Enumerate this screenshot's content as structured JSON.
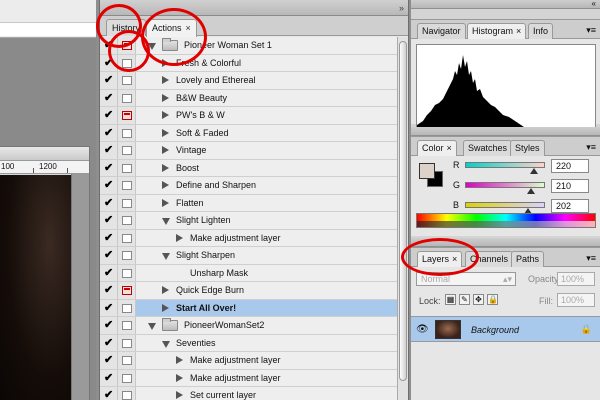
{
  "workspace": {
    "ruler_labels": [
      "100",
      "1200"
    ]
  },
  "actions_panel": {
    "tabs": [
      {
        "label": "History",
        "active": false
      },
      {
        "label": "Actions",
        "active": true,
        "close": "×"
      }
    ],
    "menu_icon": "panel-menu-icon",
    "rows": [
      {
        "check": true,
        "dialog": "red",
        "expand": "down",
        "folder": true,
        "indent": 0,
        "label": "Pioneer Woman Set 1"
      },
      {
        "check": true,
        "dialog": "empty",
        "expand": "right",
        "folder": false,
        "indent": 1,
        "label": "Fresh & Colorful"
      },
      {
        "check": true,
        "dialog": "empty",
        "expand": "right",
        "folder": false,
        "indent": 1,
        "label": "Lovely and Ethereal"
      },
      {
        "check": true,
        "dialog": "empty",
        "expand": "right",
        "folder": false,
        "indent": 1,
        "label": "B&W Beauty"
      },
      {
        "check": true,
        "dialog": "red",
        "expand": "right",
        "folder": false,
        "indent": 1,
        "label": "PW's B & W"
      },
      {
        "check": true,
        "dialog": "empty",
        "expand": "right",
        "folder": false,
        "indent": 1,
        "label": "Soft & Faded"
      },
      {
        "check": true,
        "dialog": "empty",
        "expand": "right",
        "folder": false,
        "indent": 1,
        "label": "Vintage"
      },
      {
        "check": true,
        "dialog": "empty",
        "expand": "right",
        "folder": false,
        "indent": 1,
        "label": "Boost"
      },
      {
        "check": true,
        "dialog": "empty",
        "expand": "right",
        "folder": false,
        "indent": 1,
        "label": "Define and Sharpen"
      },
      {
        "check": true,
        "dialog": "empty",
        "expand": "right",
        "folder": false,
        "indent": 1,
        "label": "Flatten"
      },
      {
        "check": true,
        "dialog": "empty",
        "expand": "down",
        "folder": false,
        "indent": 1,
        "label": "Slight Lighten"
      },
      {
        "check": true,
        "dialog": "empty",
        "expand": "right",
        "folder": false,
        "indent": 2,
        "label": "Make adjustment layer"
      },
      {
        "check": true,
        "dialog": "empty",
        "expand": "down",
        "folder": false,
        "indent": 1,
        "label": "Slight Sharpen"
      },
      {
        "check": true,
        "dialog": "empty",
        "expand": "none",
        "folder": false,
        "indent": 2,
        "label": "Unsharp Mask"
      },
      {
        "check": true,
        "dialog": "red",
        "expand": "right",
        "folder": false,
        "indent": 1,
        "label": "Quick Edge Burn"
      },
      {
        "check": true,
        "dialog": "empty",
        "expand": "right",
        "folder": false,
        "indent": 1,
        "label": "Start All Over!",
        "selected": true,
        "bold": true
      },
      {
        "check": true,
        "dialog": "empty",
        "expand": "down",
        "folder": true,
        "indent": 0,
        "label": "PioneerWomanSet2"
      },
      {
        "check": true,
        "dialog": "empty",
        "expand": "down",
        "folder": false,
        "indent": 1,
        "label": "Seventies"
      },
      {
        "check": true,
        "dialog": "empty",
        "expand": "right",
        "folder": false,
        "indent": 2,
        "label": "Make adjustment layer"
      },
      {
        "check": true,
        "dialog": "empty",
        "expand": "right",
        "folder": false,
        "indent": 2,
        "label": "Make adjustment layer"
      },
      {
        "check": true,
        "dialog": "empty",
        "expand": "right",
        "folder": false,
        "indent": 2,
        "label": "Set current layer"
      }
    ]
  },
  "navigator_panel": {
    "tabs": [
      {
        "label": "Navigator",
        "active": false
      },
      {
        "label": "Histogram",
        "active": true,
        "close": "×"
      },
      {
        "label": "Info",
        "active": false
      }
    ]
  },
  "color_panel": {
    "tabs": [
      {
        "label": "Color",
        "active": true,
        "close": "×"
      },
      {
        "label": "Swatches",
        "active": false
      },
      {
        "label": "Styles",
        "active": false
      }
    ],
    "foreground_color": "#dcd2ca",
    "background_color": "#000000",
    "channels": [
      {
        "label": "R",
        "value": "220",
        "fraction": 0.863,
        "gradient": "linear-gradient(to right, #00d2ca, #ffd2ca)"
      },
      {
        "label": "G",
        "value": "210",
        "fraction": 0.824,
        "gradient": "linear-gradient(to right, #dc00ca, #dcffca)"
      },
      {
        "label": "B",
        "value": "202",
        "fraction": 0.792,
        "gradient": "linear-gradient(to right, #dcd200, #dcd2ff)"
      }
    ]
  },
  "layers_panel": {
    "tabs": [
      {
        "label": "Layers",
        "active": true,
        "close": "×"
      },
      {
        "label": "Channels",
        "active": false
      },
      {
        "label": "Paths",
        "active": false
      }
    ],
    "blend_mode": "Normal",
    "opacity_label": "Opacity:",
    "opacity_value": "100%",
    "lock_label": "Lock:",
    "fill_label": "Fill:",
    "fill_value": "100%",
    "layer_name": "Background"
  },
  "colors": {
    "selection": "#a9c9ec",
    "annotation_red": "#e10000"
  }
}
